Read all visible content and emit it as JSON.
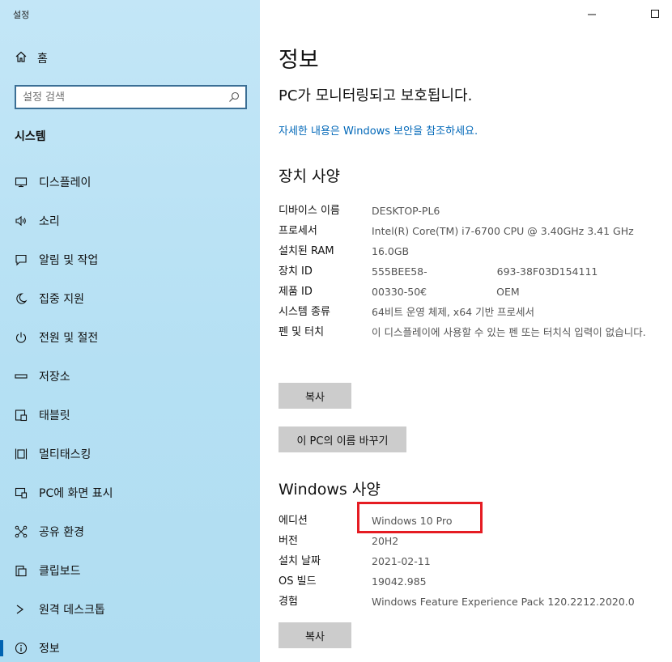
{
  "window": {
    "title": "설정"
  },
  "sidebar": {
    "home_label": "홈",
    "search_placeholder": "설정 검색",
    "section": "시스템",
    "items": [
      {
        "label": "디스플레이",
        "icon": "display-icon"
      },
      {
        "label": "소리",
        "icon": "speaker-icon"
      },
      {
        "label": "알림 및 작업",
        "icon": "notification-icon"
      },
      {
        "label": "집중 지원",
        "icon": "moon-icon"
      },
      {
        "label": "전원 및 절전",
        "icon": "power-icon"
      },
      {
        "label": "저장소",
        "icon": "storage-icon"
      },
      {
        "label": "태블릿",
        "icon": "tablet-icon"
      },
      {
        "label": "멀티태스킹",
        "icon": "multitasking-icon"
      },
      {
        "label": "PC에 화면 표시",
        "icon": "project-icon"
      },
      {
        "label": "공유 환경",
        "icon": "shared-icon"
      },
      {
        "label": "클립보드",
        "icon": "clipboard-icon"
      },
      {
        "label": "원격 데스크톱",
        "icon": "remote-desktop-icon"
      },
      {
        "label": "정보",
        "icon": "info-icon",
        "active": true
      }
    ]
  },
  "main": {
    "title": "정보",
    "status": "PC가 모니터링되고 보호됩니다.",
    "security_link": "자세한 내용은 Windows 보안을 참조하세요.",
    "device_specs": {
      "heading": "장치 사양",
      "rows": [
        {
          "key": "디바이스 이름",
          "value": "DESKTOP-PL6"
        },
        {
          "key": "프로세서",
          "value": "Intel(R) Core(TM) i7-6700 CPU @ 3.40GHz   3.41 GHz"
        },
        {
          "key": "설치된 RAM",
          "value": "16.0GB"
        },
        {
          "key": "장치 ID",
          "value": "555BEE58-",
          "value_tail": "693-38F03D154111"
        },
        {
          "key": "제품 ID",
          "value": "00330-50€",
          "value_tail": "OEM"
        },
        {
          "key": "시스템 종류",
          "value": "64비트 운영 체제, x64 기반 프로세서"
        },
        {
          "key": "펜 및 터치",
          "value": "이 디스플레이에 사용할 수 있는 펜 또는 터치식 입력이 없습니다."
        }
      ],
      "copy_button": "복사",
      "rename_button": "이 PC의 이름 바꾸기"
    },
    "windows_specs": {
      "heading": "Windows 사양",
      "rows": [
        {
          "key": "에디션",
          "value": "Windows 10 Pro"
        },
        {
          "key": "버전",
          "value": "20H2"
        },
        {
          "key": "설치 날짜",
          "value": "2021-02-11"
        },
        {
          "key": "OS 빌드",
          "value": "19042.985"
        },
        {
          "key": "경험",
          "value": "Windows Feature Experience Pack 120.2212.2020.0"
        }
      ],
      "copy_button": "복사"
    }
  },
  "colors": {
    "accent": "#0063b1",
    "link": "#0067b8",
    "highlight_box": "#e51c23",
    "sidebar_bg": "#b8e0f4"
  }
}
